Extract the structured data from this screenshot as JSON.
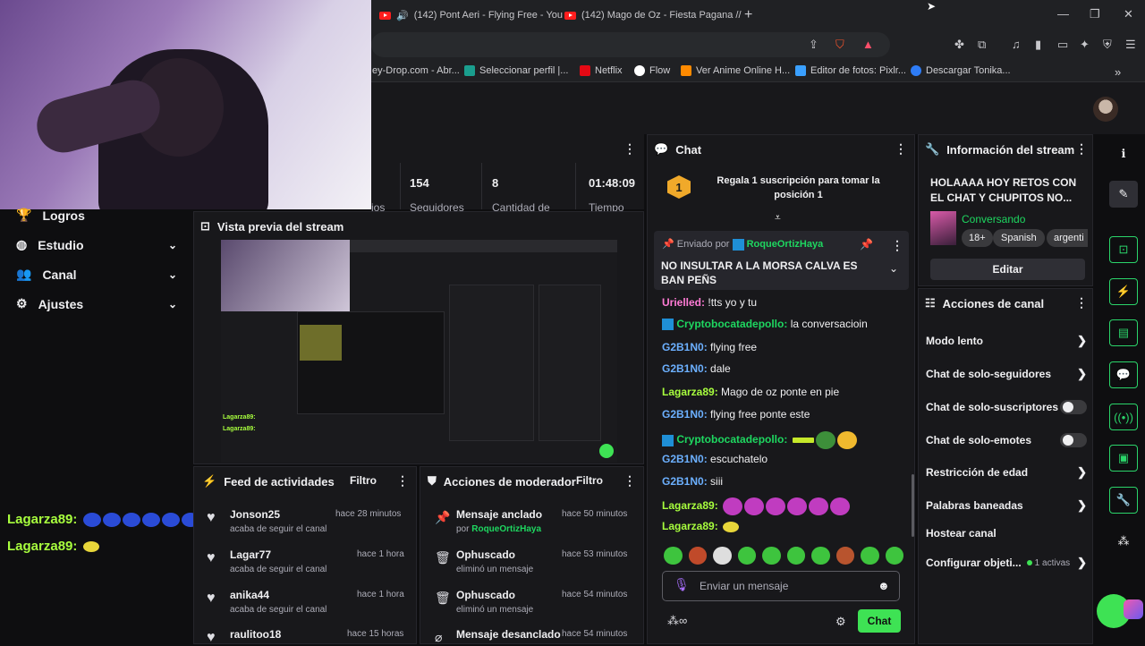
{
  "browser": {
    "tabs": [
      {
        "label": "(142) Pont Aeri - Flying Free - You"
      },
      {
        "label": "(142) Mago de Oz - Fiesta Pagana //"
      }
    ],
    "new_tab": "+",
    "bookmarks": [
      "ey-Drop.com - Abr...",
      "Seleccionar perfil |...",
      "Netflix",
      "Flow",
      "Ver Anime Online H...",
      "Editor de fotos: Pixlr...",
      "Descargar Tonika..."
    ],
    "bookmark_more": "»"
  },
  "sidebar": {
    "items": [
      {
        "label": "Logros",
        "icon": "trophy-icon",
        "glyph": "🏆",
        "chevron": false
      },
      {
        "label": "Estudio",
        "icon": "studio-icon",
        "glyph": "◍",
        "chevron": true
      },
      {
        "label": "Canal",
        "icon": "channel-icon",
        "glyph": "👥",
        "chevron": true
      },
      {
        "label": "Ajustes",
        "icon": "gear-icon",
        "glyph": "⚙",
        "chevron": true
      }
    ]
  },
  "stats": {
    "items": [
      {
        "value": "154",
        "label": "Seguidores"
      },
      {
        "value": "8",
        "label": "Cantidad de"
      },
      {
        "value": "01:48:09",
        "label": "Tiempo"
      }
    ],
    "cut_label": "ios"
  },
  "preview": {
    "title": "Vista previa del stream",
    "chat_lines": [
      "Lagarza89:",
      "Lagarza89:"
    ]
  },
  "activity": {
    "title": "Feed de actividades",
    "filter": "Filtro",
    "items": [
      {
        "name": "Jonson25",
        "sub": "acaba de seguir el canal",
        "time": "hace 28 minutos"
      },
      {
        "name": "Lagar77",
        "sub": "acaba de seguir el canal",
        "time": "hace 1 hora"
      },
      {
        "name": "anika44",
        "sub": "acaba de seguir el canal",
        "time": "hace 1 hora"
      },
      {
        "name": "raulitoo18",
        "sub": "",
        "time": "hace 15 horas"
      }
    ]
  },
  "moderator": {
    "title": "Acciones de moderador",
    "filter": "Filtro",
    "items": [
      {
        "name": "Mensaje anclado",
        "sub_prefix": "por",
        "sub_user": "RoqueOrtizHaya",
        "time": "hace 50 minutos",
        "icon": "pin-icon"
      },
      {
        "name": "Ophuscado",
        "sub_prefix": "eliminó un mensaje",
        "sub_user": "",
        "time": "hace 53 minutos",
        "icon": "trash-icon"
      },
      {
        "name": "Ophuscado",
        "sub_prefix": "eliminó un mensaje",
        "sub_user": "",
        "time": "hace 54 minutos",
        "icon": "trash-icon"
      },
      {
        "name": "Mensaje desanclado",
        "sub_prefix": "",
        "sub_user": "",
        "time": "hace 54 minutos",
        "icon": "unpin-icon"
      }
    ]
  },
  "chat": {
    "title": "Chat",
    "gift_rank": "1",
    "gift_text": "Regala 1 suscripción para tomar la posición 1",
    "pinned": {
      "sent_by": "Enviado por",
      "user": "RoqueOrtizHaya",
      "text": "NO INSULTAR A LA MORSA CALVA ES BAN PEÑS"
    },
    "messages": [
      {
        "user": "Urielled:",
        "text": "!tts yo y tu",
        "color": "#ff7bd5"
      },
      {
        "user": "Cryptobocatadepollo:",
        "text": "la conversacioin",
        "color": "#1ed760"
      },
      {
        "user": "G2B1N0:",
        "text": "flying free",
        "color": "#6cb0ff"
      },
      {
        "user": "G2B1N0:",
        "text": "dale",
        "color": "#6cb0ff"
      },
      {
        "user": "Lagarza89:",
        "text": "Mago de oz ponte en pie",
        "color": "#a8ff3e"
      },
      {
        "user": "G2B1N0:",
        "text": "flying free ponte este",
        "color": "#6cb0ff"
      },
      {
        "user": "Cryptobocatadepollo:",
        "text": "",
        "color": "#1ed760"
      },
      {
        "user": "G2B1N0:",
        "text": "escuchatelo",
        "color": "#6cb0ff"
      },
      {
        "user": "G2B1N0:",
        "text": "siii",
        "color": "#6cb0ff"
      },
      {
        "user": "Lagarza89:",
        "text": "",
        "color": "#a8ff3e"
      },
      {
        "user": "Lagarza89:",
        "text": "",
        "color": "#a8ff3e"
      }
    ],
    "input_placeholder": "Enviar un mensaje",
    "send_label": "Chat"
  },
  "overlay_chat": [
    {
      "user": "Lagarza89:"
    },
    {
      "user": "Lagarza89:"
    }
  ],
  "stream_info": {
    "title": "Información del stream",
    "stream_title": "HOLAAAA HOY RETOS CON EL CHAT Y CHUPITOS NO...",
    "category": "Conversando",
    "tags": [
      "18+",
      "Spanish",
      "argenti"
    ],
    "edit_label": "Editar"
  },
  "channel_actions": {
    "title": "Acciones de canal",
    "items": [
      {
        "label": "Modo lento",
        "control": "arrow"
      },
      {
        "label": "Chat de solo-seguidores",
        "control": "arrow"
      },
      {
        "label": "Chat de solo-suscriptores",
        "control": "toggle"
      },
      {
        "label": "Chat de solo-emotes",
        "control": "toggle"
      },
      {
        "label": "Restricción de edad",
        "control": "arrow"
      },
      {
        "label": "Palabras baneadas",
        "control": "arrow"
      },
      {
        "label": "Hostear canal",
        "control": "none"
      },
      {
        "label": "Configurar objeti...",
        "control": "arrow",
        "badge": "1 activas"
      }
    ]
  },
  "colors": {
    "accent_green": "#3ee254",
    "twitch_bg": "#18181b",
    "page_bg": "#0e0e10"
  }
}
